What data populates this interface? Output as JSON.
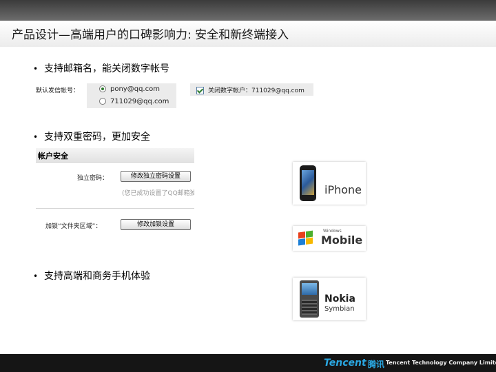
{
  "title": "产品设计—高端用户的口碑影响力: 安全和新终端接入",
  "bullets": {
    "b1": "支持邮箱名，能关闭数字帐号",
    "b2": "支持双重密码，更加安全",
    "b3": "支持高端和商务手机体验"
  },
  "email_settings": {
    "label": "默认发信帐号：",
    "options": [
      "pony@qq.com",
      "711029@qq.com"
    ],
    "selected": "pony@qq.com",
    "disable_numeric": {
      "label": "关闭数字帐户：711029@qq.com",
      "checked": true
    }
  },
  "security_panel": {
    "heading": "帐户安全",
    "independent_label": "独立密码：",
    "independent_button": "修改独立密码设置",
    "hint": "(您已成功设置了QQ邮箱独",
    "lock_label": "加锁“文件夹区域”：",
    "lock_button": "修改加锁设置"
  },
  "phones": {
    "iphone": "iPhone",
    "windows_small": "Windows",
    "windows_big": "Mobile",
    "nokia": "Nokia",
    "symbian": "Symbian"
  },
  "footer": {
    "brand": "Tencent",
    "brand_cn": "腾讯",
    "company": "Tencent Technology Company Limited"
  },
  "colors": {
    "brand_blue": "#2aa6e0",
    "footer_bg": "#151515"
  }
}
